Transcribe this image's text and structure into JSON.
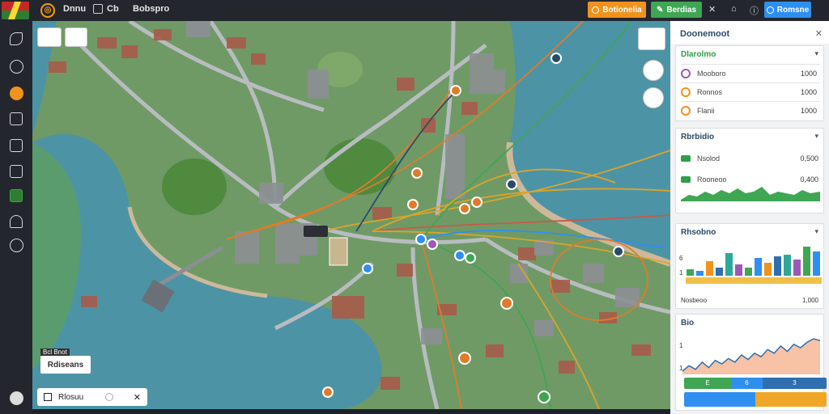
{
  "topbar": {
    "nav": [
      "Dnnu",
      "Cb",
      "Bobspro"
    ],
    "btn_orange": "Botionelia",
    "btn_green": "Berdias",
    "btn_blue": "Romsne"
  },
  "sidebar": {
    "items": [
      "map-icon",
      "globe-icon",
      "circle-icon",
      "list-icon",
      "layers-icon",
      "book-icon",
      "chart-icon",
      "user-icon",
      "settings-icon",
      "avatar-icon"
    ]
  },
  "map": {
    "label_small": "Bcl Bnot",
    "label": "Rdiseans",
    "search_value": "Rlosuu"
  },
  "panel": {
    "title": "Doonemoot",
    "card1": {
      "title": "Dlarolmo",
      "rows": [
        {
          "label": "Mooboro",
          "value": "1000",
          "color": "#9b59b6"
        },
        {
          "label": "Ronnos",
          "value": "1000",
          "color": "#f0931e"
        },
        {
          "label": "Flanii",
          "value": "1000",
          "color": "#f0931e"
        }
      ]
    },
    "card2": {
      "title": "Rbrbidio",
      "rows": [
        {
          "label": "Nsolod",
          "value": "0,500"
        },
        {
          "label": "Rooneoo",
          "value": "0,400"
        }
      ]
    },
    "card3": {
      "title": "Rhsobno",
      "bars": [
        8,
        6,
        18,
        10,
        28,
        14,
        10,
        22,
        16,
        24,
        26,
        20,
        36,
        30
      ],
      "tick1": "6",
      "tick2": "1",
      "footer_label": "Nosbeoo",
      "footer_value": "1,000"
    },
    "card4": {
      "title": "Bio",
      "line": [
        20,
        26,
        22,
        30,
        24,
        32,
        28,
        34,
        30,
        38,
        33,
        40,
        36,
        44,
        40,
        48,
        42,
        50,
        46,
        52,
        56,
        54
      ],
      "tick1": "1",
      "tick2": "1",
      "segments": [
        {
          "label": "E",
          "value": 0.33,
          "color": "#3fa654"
        },
        {
          "label": "6",
          "value": 0.22,
          "color": "#2f8ff0"
        },
        {
          "label": "3",
          "value": 0.45,
          "color": "#2f6fb0"
        }
      ],
      "progress": [
        {
          "value": 0.5,
          "color": "#2f8ff0"
        },
        {
          "value": 0.5,
          "color": "#f0a626"
        }
      ]
    }
  }
}
